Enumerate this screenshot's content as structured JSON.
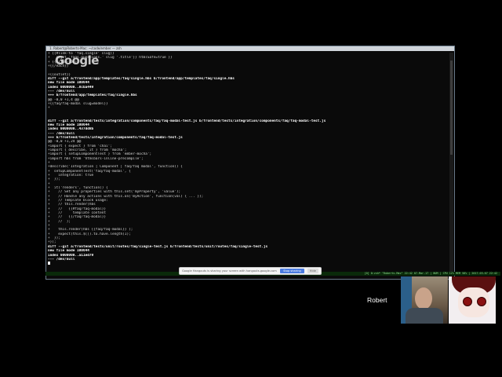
{
  "window": {
    "title": "1. Robert@Roberts-Mac: ~/code/ember — zsh"
  },
  "overlay_logo": "Google",
  "terminal": {
    "lines": [
      "+ {{#link-to 'faq.single' slug}}",
      "+   {{get 'faqs.questions.' slug '.title'}} htmlSafe=true }}",
      "+ {{/link-to}}",
      "+{{/each}}",
      "",
      "+{{outlet}}",
      "diff --git a/frontend/app/templates/faq/single.hbs b/frontend/app/templates/faq/single.hbs",
      "new file mode 100644",
      "index 0000000..8cba449",
      "--- /dev/null",
      "+++ b/frontend/app/templates/faq/single.hbs",
      "@@ -0,0 +1,4 @@",
      "+{{faq/faq-modal slug=model}}",
      "+",
      "",
      "",
      "diff --git a/frontend/tests/integration/components/faq/faq-modal-test.js b/frontend/tests/integration/components/faq/faq-modal-test.js",
      "new file mode 100644",
      "index 0000000..437dd8b",
      "--- /dev/null",
      "+++ b/frontend/tests/integration/components/faq/faq-modal-test.js",
      "@@ -0,0 +1,24 @@",
      "+import { expect } from 'chai';",
      "+import { describe, it } from 'mocha';",
      "+import { setupComponentTest } from 'ember-mocha';",
      "+import hbs from 'htmlbars-inline-precompile';",
      "+",
      "+describe('Integration | Component | faq/faq modal', function() {",
      "+  setupComponentTest('faq/faq-modal', {",
      "+    integration: true",
      "+  });",
      "+",
      "+  it('renders', function() {",
      "+    // Set any properties with this.set('myProperty', 'value');",
      "+    // Handle any actions with this.on('myAction', function(val) { ... });",
      "+    // Template block usage:",
      "+    // this.render(hbs`",
      "+    //   {{#faq/faq-modal}}",
      "+    //     template content",
      "+    //   {{/faq/faq-modal}}",
      "+    // `);",
      "+",
      "+    this.render(hbs`{{faq/faq-modal}}`);",
      "+    expect(this.$()).to.have.length(1);",
      "+  });",
      "+});",
      "diff --git a/frontend/tests/unit/routes/faq/single-test.js b/frontend/tests/unit/routes/faq/single-test.js",
      "new file mode 100644",
      "index 0000000..a11ed79",
      "--- /dev/null",
      ""
    ]
  },
  "share_notice": {
    "text": "Google Hangouts is sharing your screen with hangouts.google.com.",
    "stop_label": "Stop sharing",
    "hide_label": "Hide"
  },
  "status_bar": {
    "text": "[0] 0:zsh*   \"Roberts-Mac\" 22:42 07-Mar-17  |  NUM  |  CPU 12%  MEM 58%  |  2017-03-07 22:42"
  },
  "participant": {
    "name": "Robert"
  }
}
